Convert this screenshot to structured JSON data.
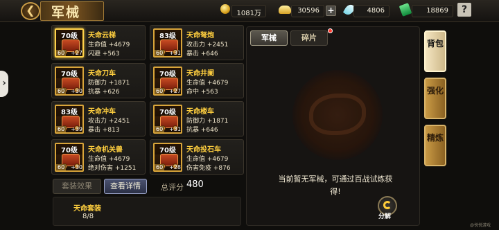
{
  "header": {
    "title": "军械",
    "resources": [
      {
        "icon": "coin-icon",
        "value": "1081万"
      },
      {
        "icon": "gold-ingot-icon",
        "value": "30596"
      },
      {
        "icon": "feather-icon",
        "value": "4806"
      },
      {
        "icon": "jade-icon",
        "value": "18869"
      }
    ],
    "help_label": "?",
    "back_label": "❮"
  },
  "weapons": [
    {
      "level": "70级",
      "name": "天命云梯",
      "stat1": "生命值 +4679",
      "stat2": "闪避 +563",
      "rank": "60",
      "plus": "+27",
      "selected": true
    },
    {
      "level": "83级",
      "name": "天命弩炮",
      "stat1": "攻击力 +2451",
      "stat2": "暴击 +646",
      "rank": "60",
      "plus": "+31",
      "selected": false
    },
    {
      "level": "70级",
      "name": "天命刀车",
      "stat1": "防御力 +1871",
      "stat2": "抗暴 +626",
      "rank": "60",
      "plus": "+30",
      "selected": false
    },
    {
      "level": "70级",
      "name": "天命井阑",
      "stat1": "生命值 +4679",
      "stat2": "命中 +563",
      "rank": "60",
      "plus": "+27",
      "selected": false
    },
    {
      "level": "83级",
      "name": "天命冲车",
      "stat1": "攻击力 +2451",
      "stat2": "暴击 +813",
      "rank": "60",
      "plus": "+39",
      "selected": false
    },
    {
      "level": "70级",
      "name": "天命楼车",
      "stat1": "防御力 +1871",
      "stat2": "抗暴 +646",
      "rank": "60",
      "plus": "+31",
      "selected": false
    },
    {
      "level": "70级",
      "name": "天命机关兽",
      "stat1": "生命值 +4679",
      "stat2": "绝对伤害 +1251",
      "rank": "60",
      "plus": "+30",
      "selected": false
    },
    {
      "level": "70级",
      "name": "天命投石车",
      "stat1": "生命值 +4679",
      "stat2": "伤害免疫 +876",
      "rank": "60",
      "plus": "+28",
      "selected": false
    }
  ],
  "bottom": {
    "set_effect_label": "套装效果",
    "detail_label": "查看详情",
    "score_label": "总评分",
    "score_value": "480",
    "set_name": "天命套装",
    "set_count": "8/8"
  },
  "right_panel": {
    "tab_weapons": "军械",
    "tab_fragments": "碎片",
    "empty_message": "当前暂无军械，可通过百战试炼获得!",
    "decompose_label": "分解"
  },
  "side_tabs": {
    "bag": "背包",
    "enhance": "强化",
    "refine": "精炼"
  },
  "watermark": "@悦悦游戏"
}
